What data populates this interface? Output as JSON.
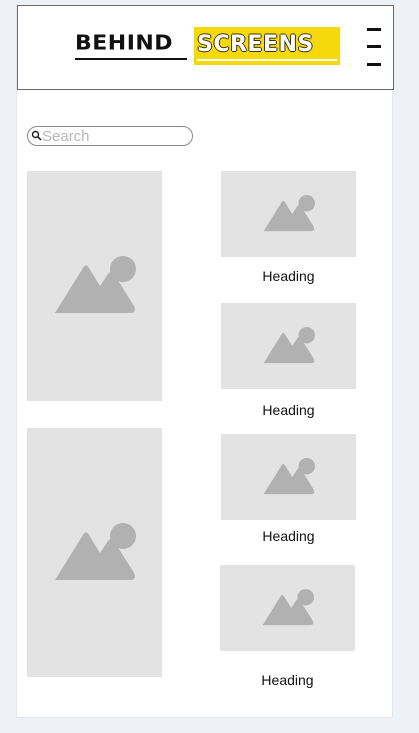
{
  "header": {
    "logo_left": "BEHIND",
    "logo_right": "SCREENS",
    "menu_icon": "hamburger-menu-icon",
    "colors": {
      "logo_yellow": "#f5d90a",
      "logo_dark": "#111111"
    }
  },
  "search": {
    "placeholder": "Search",
    "value": "",
    "icon": "search-icon"
  },
  "gallery": {
    "placeholder_icon": "image-placeholder-icon",
    "placeholder_color": "#e3e3e3",
    "icon_color": "#b1b1b1",
    "cards": [
      {
        "heading": "Heading"
      },
      {
        "heading": "Heading"
      },
      {
        "heading": "Heading"
      },
      {
        "heading": "Heading"
      }
    ]
  }
}
